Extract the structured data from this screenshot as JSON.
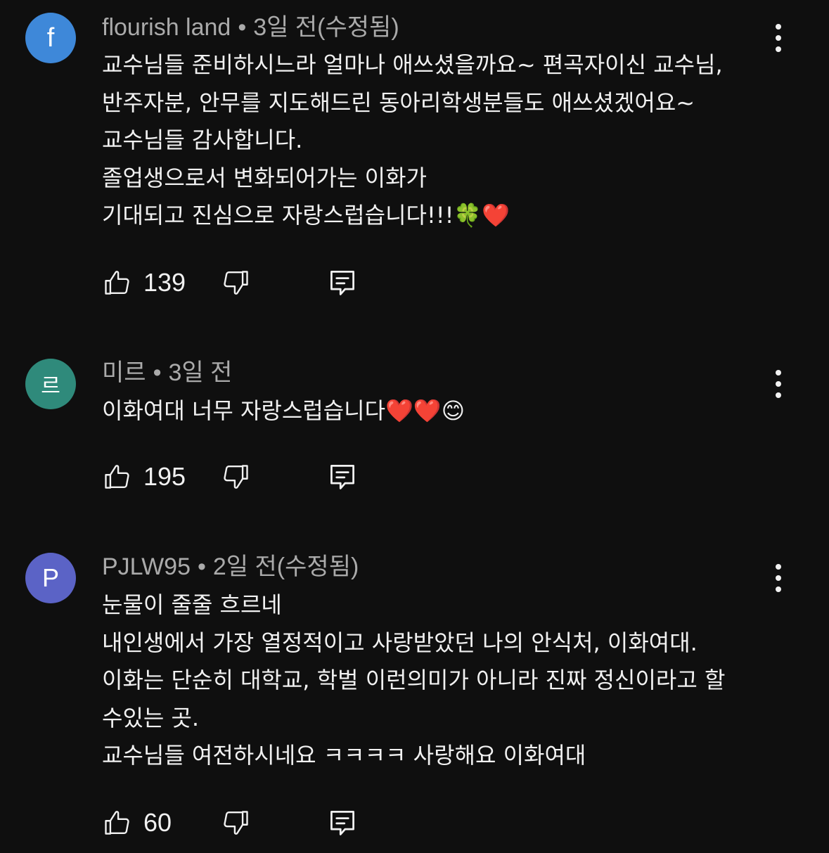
{
  "comments": [
    {
      "avatar_letter": "f",
      "avatar_color": "#3e88d9",
      "author": "flourish land",
      "separator": "•",
      "time": "3일 전(수정됨)",
      "lines": [
        "교수님들 준비하시느라 얼마나 애쓰셨을까요~ 편곡자이신 교수님,",
        "반주자분, 안무를 지도해드린 동아리학생분들도 애쓰셨겠어요~",
        "교수님들 감사합니다.",
        "졸업생으로서 변화되어가는 이화가",
        "기대되고 진심으로 자랑스럽습니다!!!🍀❤️"
      ],
      "likes": "139"
    },
    {
      "avatar_letter": "르",
      "avatar_color": "#2f8a7b",
      "author": "미르",
      "separator": "•",
      "time": "3일 전",
      "lines": [
        "이화여대 너무 자랑스럽습니다❤️❤️😊"
      ],
      "likes": "195"
    },
    {
      "avatar_letter": "P",
      "avatar_color": "#5b63c6",
      "author": "PJLW95",
      "separator": "•",
      "time": "2일 전(수정됨)",
      "lines": [
        "눈물이 줄줄 흐르네",
        "내인생에서 가장 열정적이고 사랑받았던 나의 안식처, 이화여대.",
        "이화는 단순히 대학교, 학벌 이런의미가 아니라 진짜 정신이라고 할",
        "수있는 곳.",
        "교수님들 여전하시네요 ㅋㅋㅋㅋ 사랑해요 이화여대"
      ],
      "likes": "60"
    }
  ],
  "icons": {
    "like": "thumbs-up-icon",
    "dislike": "thumbs-down-icon",
    "reply": "reply-icon",
    "more": "more-vertical-icon"
  }
}
